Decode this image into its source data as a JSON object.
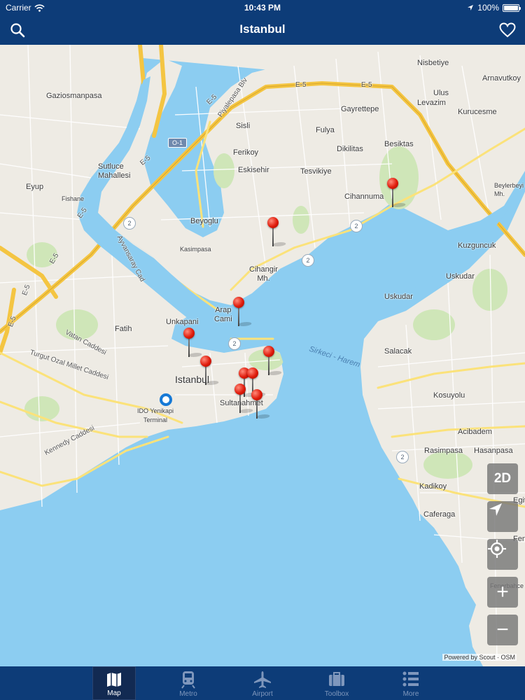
{
  "status_bar": {
    "carrier": "Carrier",
    "time": "10:43 PM",
    "battery": "100%",
    "battery_level": 1.0,
    "icons": [
      "wifi-icon",
      "location-arrow-icon",
      "battery-icon"
    ]
  },
  "nav_bar": {
    "title": "Istanbul",
    "left_icon": "search-icon",
    "right_icon": "heart-icon"
  },
  "map": {
    "labels": {
      "gaziosmanpasa": "Gaziosmanpasa",
      "sutluce": "Sutluce\nMahallesi",
      "eyup": "Eyup",
      "fishane": "Fishane",
      "beyoglu": "Beyoglu",
      "kasimpasa": "Kasimpasa",
      "sisli": "Sisli",
      "ferikoy": "Ferikoy",
      "eskisehir": "Eskisehir",
      "fulya": "Fulya",
      "gayrettepe": "Gayrettepe",
      "dikilitas": "Dikilitas",
      "tesvikiye": "Tesvikiye",
      "besiktas": "Besiktas",
      "cihannuma": "Cihannuma",
      "cihangir": "Cihangir\nMh.",
      "arap_cami": "Arap\nCami",
      "unkapani": "Unkapani",
      "fatih": "Fatih",
      "istanbul": "Istanbul",
      "sultanahmet": "Sultanahmet",
      "ido": "IDO Yenikapi\nTerminal",
      "nisbetiye": "Nisbetiye",
      "arnavutkoy": "Arnavutkoy",
      "ulus": "Ulus",
      "levazim": "Levazim",
      "kurucesme": "Kurucesme",
      "beylerbeyi": "Beylerbeyi\nMh.",
      "kuzguncuk": "Kuzguncuk",
      "uskudar1": "Uskudar",
      "uskudar2": "Uskudar",
      "salacak": "Salacak",
      "kosuyolu": "Kosuyolu",
      "acibadem": "Acibadem",
      "rasimpasa": "Rasimpasa",
      "hasanpasa": "Hasanpasa",
      "kadikoy": "Kadikoy",
      "caferaga": "Caferaga",
      "egit": "Egit",
      "fen": "Fen",
      "fenerbahce": "Fenerbahce",
      "sirkeci": "Sirkeci - Harem",
      "piyalepasa": "Piyalepasa Blv",
      "ayvansaray": "Ayvansaray Cad",
      "vatan": "Vatan Caddesi",
      "turgut": "Turgut Ozal Millet Caddesi",
      "kennedy": "Kennedy Caddesi",
      "e5_1": "E-5",
      "e5_2": "E-5",
      "e5_3": "E-5",
      "e5_4": "E-5",
      "e5_5": "E-5",
      "e5_6": "E-5",
      "e5_7": "E-5",
      "e5_8": "E-5",
      "o1": "O-1"
    },
    "metro_marker_label": "2",
    "controls": {
      "mode_label": "2D",
      "navigate_icon": "navigation-arrow-icon",
      "locate_icon": "crosshair-icon",
      "zoom_in_label": "+",
      "zoom_out_label": "−"
    },
    "attribution": "Powered by Scout · OSM"
  },
  "tab_bar": {
    "tabs": [
      {
        "label": "Map",
        "icon": "map-icon",
        "active": true
      },
      {
        "label": "Metro",
        "icon": "train-icon",
        "active": false
      },
      {
        "label": "Airport",
        "icon": "airplane-icon",
        "active": false
      },
      {
        "label": "Toolbox",
        "icon": "toolbox-icon",
        "active": false
      },
      {
        "label": "More",
        "icon": "list-icon",
        "active": false
      }
    ]
  },
  "colors": {
    "bar_background": "#0d3c78",
    "water": "#8ccdf1",
    "land": "#eeebe4",
    "park": "#cfe6b8",
    "highway": "#f4c542",
    "pin": "#e01b0b",
    "location_dot": "#1679d6"
  }
}
